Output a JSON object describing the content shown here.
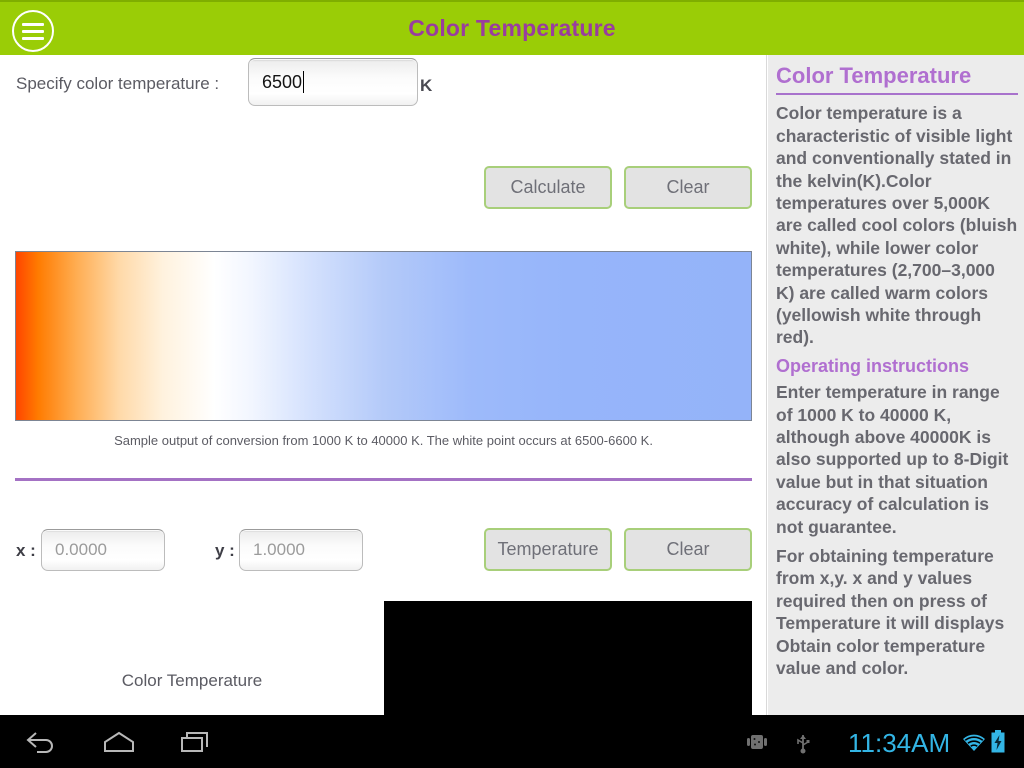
{
  "titlebar": {
    "title": "Color Temperature",
    "menu_icon": "hamburger-menu-icon",
    "bg_color": "#9acd06",
    "title_color": "#993d9e"
  },
  "form": {
    "specify_label": "Specify color temperature :",
    "temperature_value": "6500",
    "temperature_placeholder": "",
    "unit_label": "K",
    "calculate_label": "Calculate",
    "clear_label": "Clear"
  },
  "gradient": {
    "caption": "Sample output of conversion from 1000 K to 40000 K. The white point occurs at 6500-6600 K.",
    "start_color": "#ff4500",
    "white_point_color": "#ffffff",
    "end_color": "#94b3f9"
  },
  "divider_color": "#a472c4",
  "xy": {
    "x_label": "x :",
    "x_value": "0.0000",
    "y_label": "y :",
    "y_value": "1.0000",
    "temperature_label": "Temperature",
    "clear_label": "Clear"
  },
  "result": {
    "label": "Color Temperature",
    "swatch_color": "#000000"
  },
  "sidepanel": {
    "title": "Color Temperature",
    "paragraph1": "Color temperature is a characteristic of visible light and conventionally stated in the kelvin(K).Color temperatures over 5,000K are called cool colors (bluish white), while lower color temperatures (2,700–3,000 K) are called warm colors (yellowish white through red).",
    "subheading": "Operating instructions",
    "paragraph2": "Enter temperature in range of 1000 K to 40000 K, although above 40000K is also supported up to 8-Digit value but in that situation accuracy of calculation is not guarantee.",
    "paragraph3": "For obtaining temperature from x,y. x and y values required then on press of Temperature it will displays Obtain color temperature value and color.",
    "accent_color": "#b06fd0"
  },
  "navbar": {
    "back_icon": "back-arrow-icon",
    "home_icon": "home-icon",
    "recents_icon": "recent-apps-icon",
    "android_debug_icon": "android-debug-icon",
    "usb_icon": "usb-icon",
    "clock": "11:34AM",
    "wifi_icon": "wifi-icon",
    "battery_icon": "battery-charging-icon",
    "clock_color": "#33b5e5"
  }
}
